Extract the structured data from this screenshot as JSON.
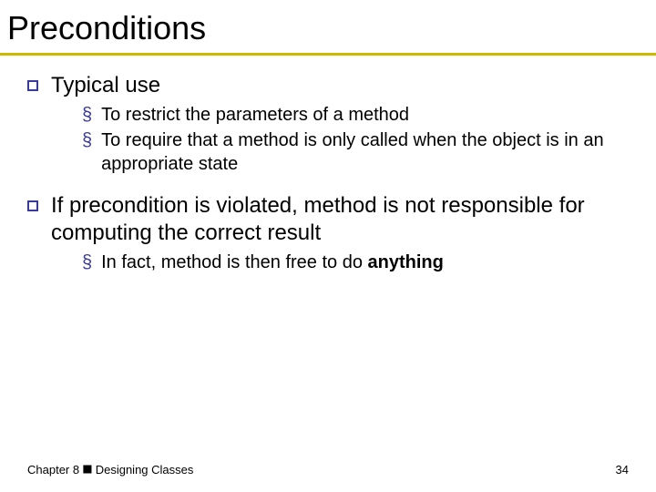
{
  "title": "Preconditions",
  "items": [
    {
      "text": "Typical use",
      "sub": [
        "To restrict the parameters of a method",
        "To require that a method is only called when the object is in an appropriate state"
      ]
    },
    {
      "text": "If precondition is violated, method is not responsible for computing the correct result",
      "sub_prefix": "In fact, method is then free to do ",
      "sub_bold": "anything"
    }
  ],
  "footer": {
    "left": "Chapter 8 ⯀ Designing Classes",
    "right": "34"
  }
}
